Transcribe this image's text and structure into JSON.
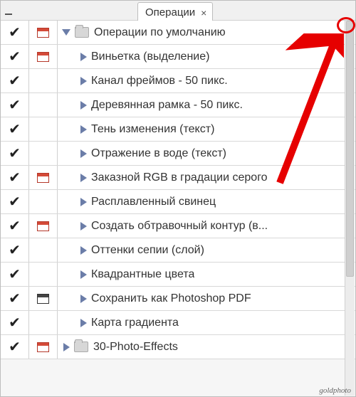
{
  "panel": {
    "tab_label": "Операции",
    "folder1_label": "Операции по умолчанию",
    "folder2_label": "30-Photo-Effects",
    "items": [
      {
        "label": "Виньетка (выделение)",
        "dialog": "red"
      },
      {
        "label": "Канал фреймов - 50 пикс.",
        "dialog": "none"
      },
      {
        "label": "Деревянная рамка - 50 пикс.",
        "dialog": "none"
      },
      {
        "label": "Тень изменения (текст)",
        "dialog": "none"
      },
      {
        "label": "Отражение в воде (текст)",
        "dialog": "none"
      },
      {
        "label": "Заказной RGB в градации серого",
        "dialog": "red"
      },
      {
        "label": "Расплавленный свинец",
        "dialog": "none"
      },
      {
        "label": "Создать обтравочный контур (в...",
        "dialog": "red"
      },
      {
        "label": "Оттенки сепии (слой)",
        "dialog": "none"
      },
      {
        "label": "Квадрантные цвета",
        "dialog": "none"
      },
      {
        "label": "Сохранить как Photoshop PDF",
        "dialog": "black"
      },
      {
        "label": "Карта градиента",
        "dialog": "none"
      }
    ]
  },
  "watermark": "goldphoto"
}
